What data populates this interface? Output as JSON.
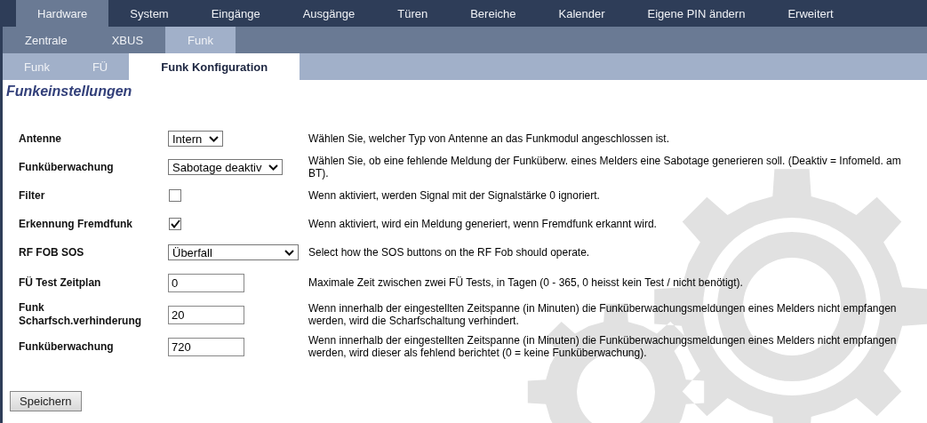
{
  "main_menu": [
    {
      "label": "Hardware",
      "selected": true
    },
    {
      "label": "System",
      "selected": false
    },
    {
      "label": "Eingänge",
      "selected": false
    },
    {
      "label": "Ausgänge",
      "selected": false
    },
    {
      "label": "Türen",
      "selected": false
    },
    {
      "label": "Bereiche",
      "selected": false
    },
    {
      "label": "Kalender",
      "selected": false
    },
    {
      "label": "Eigene PIN ändern",
      "selected": false
    },
    {
      "label": "Erweitert",
      "selected": false
    }
  ],
  "sub_menu": [
    {
      "label": "Zentrale",
      "selected": false
    },
    {
      "label": "XBUS",
      "selected": false
    },
    {
      "label": "Funk",
      "selected": true
    }
  ],
  "tabs": [
    {
      "label": "Funk",
      "selected": false
    },
    {
      "label": "FÜ",
      "selected": false
    },
    {
      "label": "Funk Konfiguration",
      "selected": true
    }
  ],
  "title": "Funkeinstellungen",
  "settings": [
    {
      "kind": "select",
      "label": "Antenne",
      "value": "Intern",
      "description": "Wählen Sie, welcher Typ von Antenne an das Funkmodul angeschlossen ist."
    },
    {
      "kind": "select",
      "label": "Funküberwachung",
      "value": "Sabotage deaktiv",
      "description": "Wählen Sie, ob eine fehlende Meldung der Funküberw. eines Melders eine Sabotage generieren soll. (Deaktiv = Infomeld. am BT)."
    },
    {
      "kind": "checkbox",
      "label": "Filter",
      "checked": false,
      "description": "Wenn aktiviert, werden Signal mit der Signalstärke 0 ignoriert."
    },
    {
      "kind": "checkbox",
      "label": "Erkennung Fremdfunk",
      "checked": true,
      "description": "Wenn aktiviert, wird ein Meldung generiert, wenn Fremdfunk erkannt wird."
    },
    {
      "kind": "select",
      "label": "RF FOB SOS",
      "value": "Überfall",
      "description": "Select how the SOS buttons on the RF Fob should operate."
    },
    {
      "kind": "text",
      "label": "FÜ Test Zeitplan",
      "value": "0",
      "description": "Maximale Zeit zwischen zwei FÜ Tests, in Tagen (0 - 365, 0 heisst kein Test / nicht benötigt)."
    },
    {
      "kind": "text",
      "label": "Funk Scharfsch.verhinderung",
      "value": "20",
      "description": "Wenn innerhalb der eingestellten Zeitspanne (in Minuten) die Funküberwachungsmeldungen eines Melders nicht empfangen werden, wird die Scharfschaltung verhindert."
    },
    {
      "kind": "text",
      "label": "Funküberwachung",
      "value": "720",
      "description": "Wenn innerhalb der eingestellten Zeitspanne (in Minuten) die Funküberwachungsmeldungen eines Melders nicht empfangen werden, wird dieser als fehlend berichtet (0 = keine Funküberwachung)."
    }
  ],
  "save_button": "Speichern"
}
